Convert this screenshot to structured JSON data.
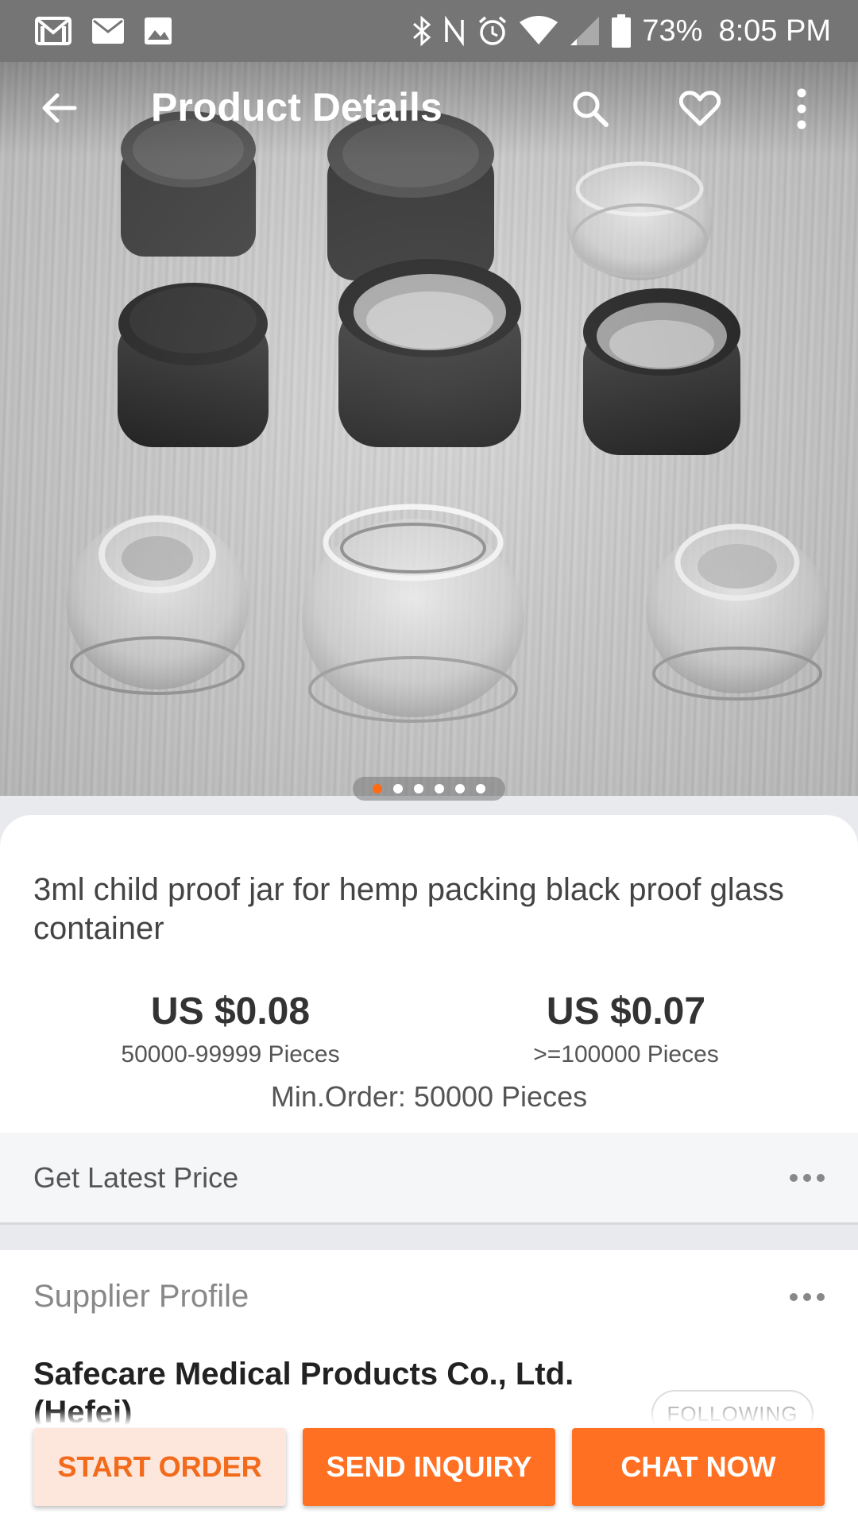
{
  "status_bar": {
    "left_icons": [
      "gmail-icon",
      "mail-icon",
      "image-icon"
    ],
    "right_icons": [
      "bluetooth-icon",
      "nfc-icon",
      "alarm-icon",
      "wifi-icon",
      "signal-icon",
      "battery-icon"
    ],
    "battery": "73%",
    "time": "8:05 PM"
  },
  "toolbar": {
    "title": "Product Details",
    "icons": [
      "back-arrow-icon",
      "search-icon",
      "heart-icon",
      "more-vert-icon"
    ]
  },
  "gallery": {
    "image_count": 6,
    "active_index": 0,
    "accent_color": "#ff6a14"
  },
  "product": {
    "title": "3ml child proof jar for hemp packing black proof glass container",
    "prices": [
      {
        "value": "US $0.08",
        "range": "50000-99999 Pieces"
      },
      {
        "value": "US $0.07",
        "range": ">=100000 Pieces"
      }
    ],
    "min_order": "Min.Order: 50000 Pieces"
  },
  "latest_price": {
    "label": "Get Latest Price"
  },
  "supplier": {
    "section_label": "Supplier Profile",
    "name": "Safecare Medical Products Co., Ltd. (Hefei)",
    "follow_label": "FOLLOWING"
  },
  "actions": {
    "start_order": "START ORDER",
    "send_inquiry": "SEND INQUIRY",
    "chat_now": "CHAT NOW",
    "brand_color": "#ff7022"
  }
}
